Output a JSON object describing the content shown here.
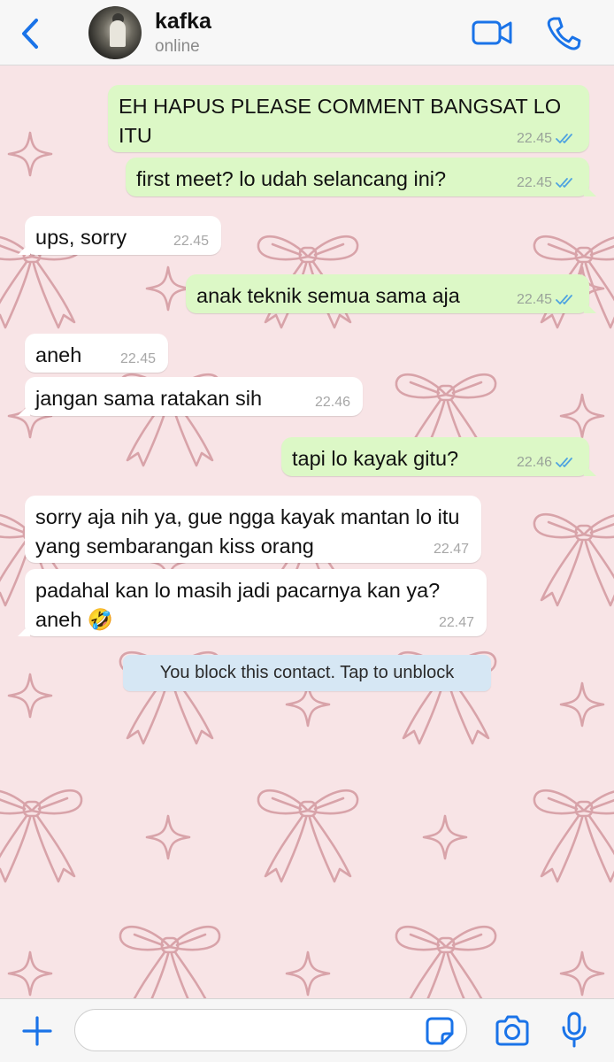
{
  "header": {
    "contact_name": "kafka",
    "status": "online"
  },
  "colors": {
    "accent": "#1a73e8",
    "outgoing_bubble": "#dcf8c6",
    "incoming_bubble": "#ffffff",
    "system_banner": "#d6e7f4",
    "wallpaper": "#f8e4e6",
    "read_ticks": "#4fa3e0"
  },
  "messages": [
    {
      "dir": "out",
      "text": "EH HAPUS PLEASE COMMENT BANGSAT LO ITU",
      "time": "22.45",
      "status": "read"
    },
    {
      "dir": "out",
      "text": "first meet? lo udah selancang ini?",
      "time": "22.45",
      "status": "read"
    },
    {
      "dir": "in",
      "text": "ups, sorry",
      "time": "22.45"
    },
    {
      "dir": "out",
      "text": "anak teknik semua sama aja",
      "time": "22.45",
      "status": "read"
    },
    {
      "dir": "in",
      "text": "aneh",
      "time": "22.45"
    },
    {
      "dir": "in",
      "text": "jangan sama ratakan sih",
      "time": "22.46"
    },
    {
      "dir": "out",
      "text": "tapi lo kayak gitu?",
      "time": "22.46",
      "status": "read"
    },
    {
      "dir": "in",
      "text": "sorry aja nih ya, gue ngga kayak mantan lo itu yang sembarangan kiss orang",
      "time": "22.47"
    },
    {
      "dir": "in",
      "text": "padahal kan lo masih jadi pacarnya kan ya? aneh 🤣",
      "time": "22.47"
    }
  ],
  "system_notice": "You block this contact. Tap to unblock",
  "composer": {
    "placeholder": ""
  },
  "icons": [
    "back-chevron-icon",
    "video-call-icon",
    "phone-icon",
    "plus-icon",
    "sticker-icon",
    "camera-icon",
    "microphone-icon",
    "double-check-icon"
  ]
}
